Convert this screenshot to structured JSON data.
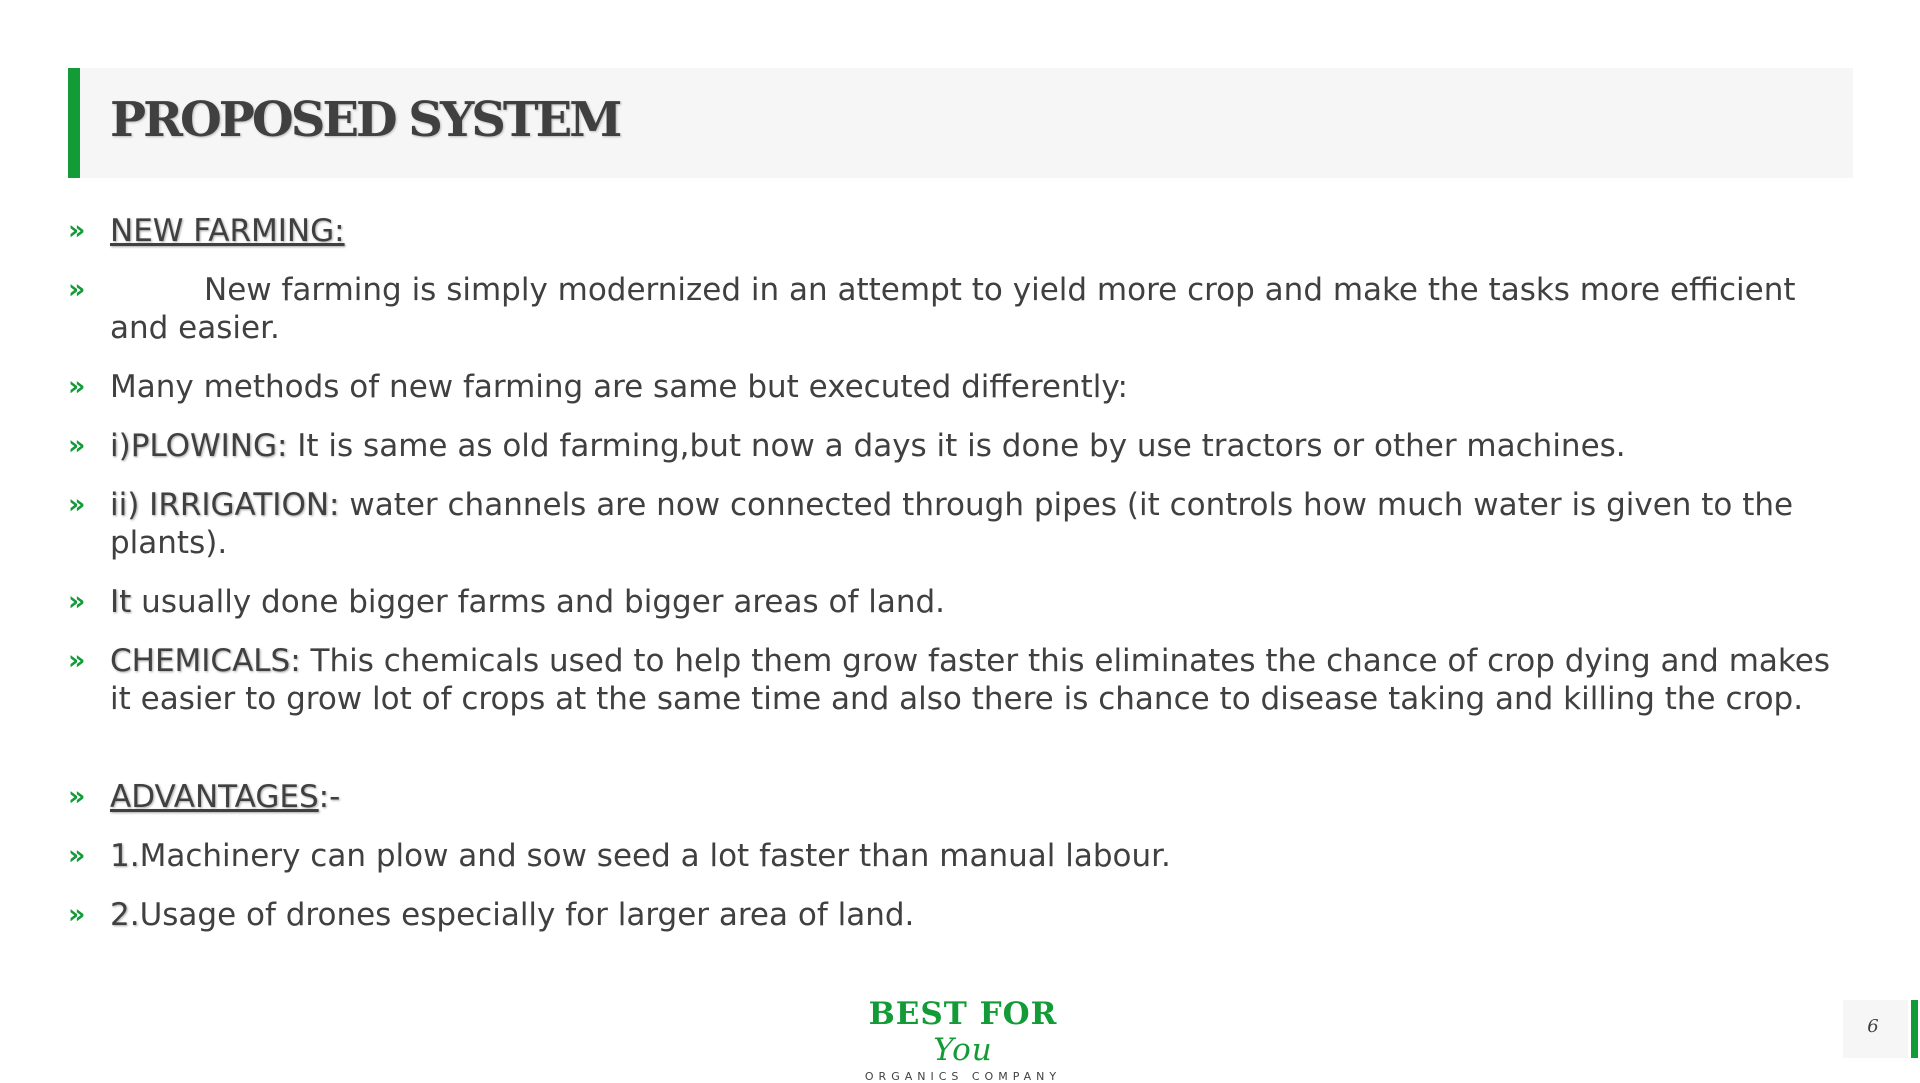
{
  "slide": {
    "title": "PROPOSED SYSTEM",
    "page_number": "6"
  },
  "colors": {
    "accent": "#129b37",
    "text": "#404040",
    "band": "#f6f6f6"
  },
  "bullet_marker": "»",
  "bullets": {
    "new_farming_heading": "NEW FARMING:",
    "intro": "New farming is simply modernized in an attempt to yield more crop and make the tasks more efficient and easier.",
    "methods": "Many methods of new farming are same but executed differently:",
    "plowing_label": "i)PLOWING:",
    "plowing_text": " It is same as old farming,but now a days it is done by use tractors or other machines.",
    "irrigation_label": "ii) IRRIGATION:",
    "irrigation_text": " water channels are now connected through pipes (it controls how much water is given to the plants).",
    "scale_label": "It",
    "scale_text": " usually done bigger farms and bigger areas of land.",
    "chemicals_label": "CHEMICALS:",
    "chemicals_text": " This chemicals used to help them grow faster this eliminates the chance of crop dying and makes it easier to grow lot of crops at the same time and also there is chance to disease taking and killing the crop.",
    "advantages_heading": "ADVANTAGES",
    "advantages_suffix": ":-",
    "adv1_num": "1.",
    "adv1_text": "Machinery can plow and sow seed a lot  faster than manual labour.",
    "adv2_num": "2.",
    "adv2_text": "Usage of drones especially for larger area of land."
  },
  "logo": {
    "main": "BEST FOR ",
    "script": "You",
    "sub": "ORGANICS COMPANY"
  }
}
